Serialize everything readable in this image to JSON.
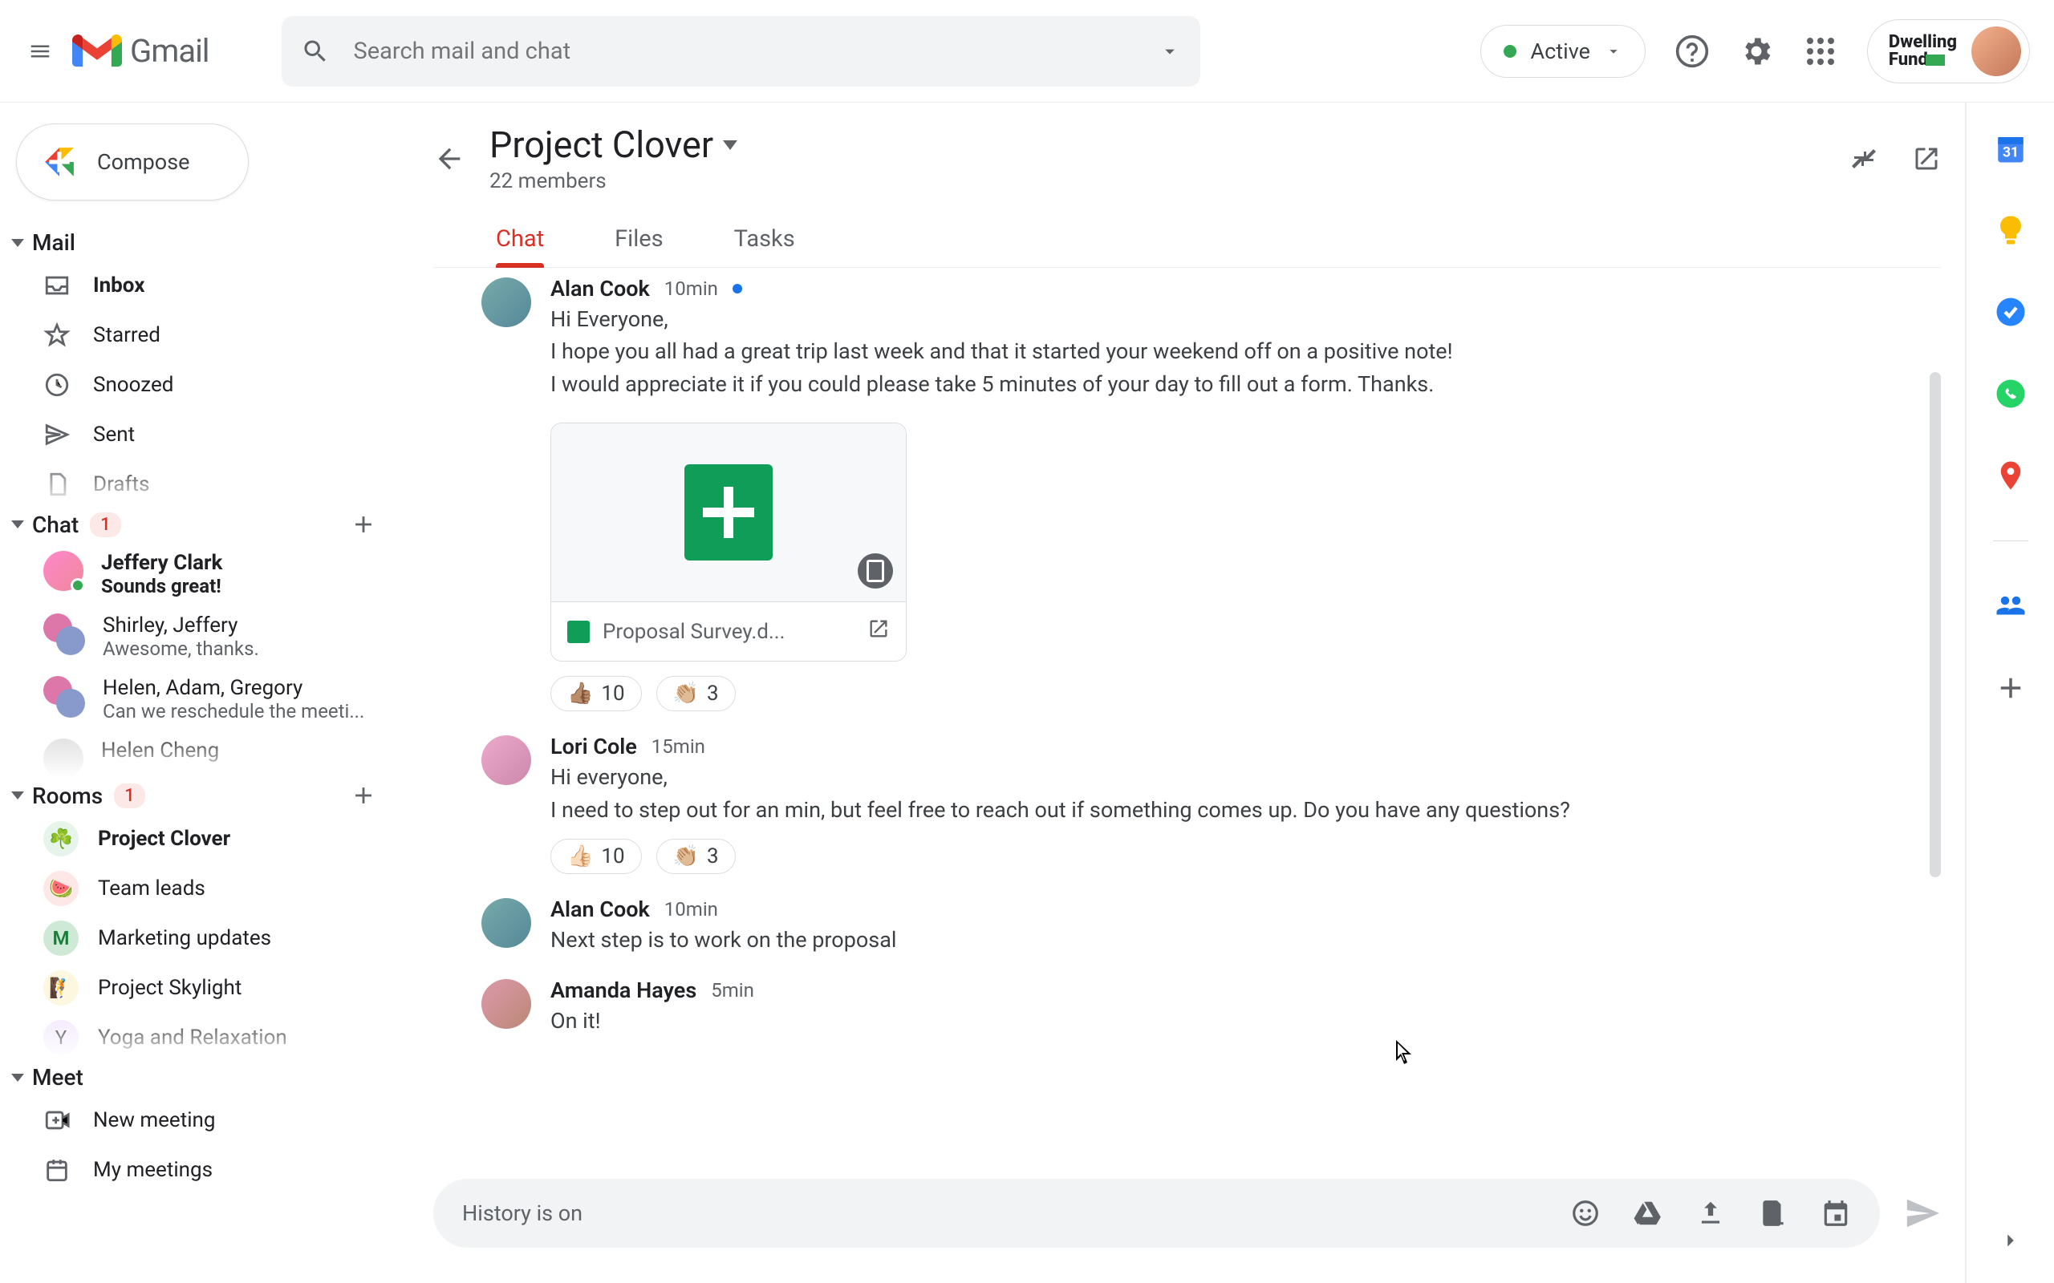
{
  "header": {
    "logo_text": "Gmail",
    "search_placeholder": "Search mail and chat",
    "status_label": "Active",
    "company_line1": "Dwelling",
    "company_line2": "Fund"
  },
  "compose_label": "Compose",
  "sections": {
    "mail": {
      "title": "Mail",
      "items": [
        {
          "label": "Inbox",
          "bold": true,
          "icon": "inbox"
        },
        {
          "label": "Starred",
          "icon": "star"
        },
        {
          "label": "Snoozed",
          "icon": "clock"
        },
        {
          "label": "Sent",
          "icon": "send"
        },
        {
          "label": "Drafts",
          "icon": "file"
        }
      ]
    },
    "chat": {
      "title": "Chat",
      "badge": "1",
      "items": [
        {
          "name": "Jeffery Clark",
          "preview": "Sounds great!",
          "bold": true,
          "presence": true,
          "avatar": "single"
        },
        {
          "name": "Shirley, Jeffery",
          "preview": "Awesome, thanks.",
          "avatar": "dual"
        },
        {
          "name": "Helen, Adam, Gregory",
          "preview": "Can we reschedule the meeti...",
          "avatar": "dual"
        }
      ],
      "more": "Helen Cheng"
    },
    "rooms": {
      "title": "Rooms",
      "badge": "1",
      "items": [
        {
          "label": "Project Clover",
          "sel": true,
          "emoji": "☘️",
          "bg": "#e6f4ea"
        },
        {
          "label": "Team leads",
          "emoji": "🍉",
          "bg": "#fde7e7"
        },
        {
          "label": "Marketing updates",
          "emoji": "M",
          "bg": "#ceead6",
          "text": true
        },
        {
          "label": "Project Skylight",
          "emoji": "🧗",
          "bg": "#fef7e0"
        }
      ],
      "more": "Yoga and Relaxation"
    },
    "meet": {
      "title": "Meet",
      "items": [
        {
          "label": "New meeting",
          "icon": "newmeet"
        },
        {
          "label": "My meetings",
          "icon": "calendar"
        }
      ]
    }
  },
  "room": {
    "title": "Project Clover",
    "subtitle": "22 members",
    "tabs": [
      "Chat",
      "Files",
      "Tasks"
    ],
    "active_tab": 0,
    "composer_hint": "History is on"
  },
  "messages": [
    {
      "author": "Alan Cook",
      "time": "10min",
      "new": true,
      "lines": [
        "Hi Everyone,",
        "I hope you all had a great trip last week and that it started your weekend off on a positive note!",
        "I would appreciate it if you could please take 5 minutes of your day to fill out a form. Thanks."
      ],
      "attachment": {
        "name": "Proposal Survey.d..."
      },
      "reactions": [
        {
          "e": "👍🏽",
          "n": "10"
        },
        {
          "e": "👏🏼",
          "n": "3"
        }
      ]
    },
    {
      "author": "Lori Cole",
      "time": "15min",
      "lines": [
        "Hi everyone,",
        "I need to step out for an min, but feel free to reach out if something comes up.  Do you have any questions?"
      ],
      "reactions": [
        {
          "e": "👍🏻",
          "n": "10"
        },
        {
          "e": "👏🏼",
          "n": "3"
        }
      ]
    },
    {
      "author": "Alan Cook",
      "time": "10min",
      "lines": [
        "Next step is to work on the proposal"
      ]
    },
    {
      "author": "Amanda Hayes",
      "time": "5min",
      "lines": [
        "On it!"
      ]
    }
  ]
}
